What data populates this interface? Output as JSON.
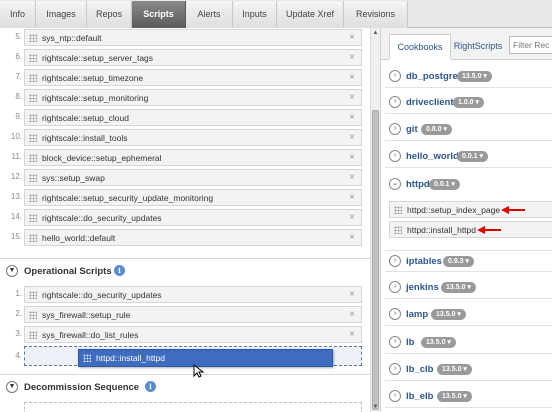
{
  "tabs": [
    "Info",
    "Images",
    "Repos",
    "Scripts",
    "Alerts",
    "Inputs",
    "Update Xref",
    "Revisions"
  ],
  "active_tab": "Scripts",
  "boot_scripts": [
    {
      "num": "5.",
      "name": "sys_ntp::default"
    },
    {
      "num": "6.",
      "name": "rightscale::setup_server_tags"
    },
    {
      "num": "7.",
      "name": "rightscale::setup_timezone"
    },
    {
      "num": "8.",
      "name": "rightscale::setup_monitoring"
    },
    {
      "num": "9.",
      "name": "rightscale::setup_cloud"
    },
    {
      "num": "10.",
      "name": "rightscale::install_tools"
    },
    {
      "num": "11.",
      "name": "block_device::setup_ephemeral"
    },
    {
      "num": "12.",
      "name": "sys::setup_swap"
    },
    {
      "num": "13.",
      "name": "rightscale::setup_security_update_monitoring"
    },
    {
      "num": "14.",
      "name": "rightscale::do_security_updates"
    },
    {
      "num": "15.",
      "name": "hello_world::default"
    }
  ],
  "remove_symbol": "×",
  "operational": {
    "title": "Operational Scripts",
    "scripts": [
      {
        "num": "1.",
        "name": "rightscale::do_security_updates"
      },
      {
        "num": "2.",
        "name": "sys_firewall::setup_rule"
      },
      {
        "num": "3.",
        "name": "sys_firewall::do_list_rules"
      }
    ],
    "drop_num": "4.",
    "dragging": "httpd::install_httpd"
  },
  "decommission": {
    "title": "Decommission Sequence"
  },
  "info_symbol": "i",
  "right_panel": {
    "tabs": [
      "Cookbooks",
      "RightScripts"
    ],
    "active_tab": "Cookbooks",
    "filter_placeholder": "Filter Rec",
    "cookbooks": [
      {
        "name": "db_postgres",
        "version": "13.5.0",
        "expanded": false
      },
      {
        "name": "driveclient",
        "version": "1.0.0",
        "expanded": false
      },
      {
        "name": "git",
        "version": "0.8.0",
        "expanded": false
      },
      {
        "name": "hello_world",
        "version": "0.0.1",
        "expanded": false
      },
      {
        "name": "httpd",
        "version": "0.0.1",
        "expanded": true
      },
      {
        "name": "iptables",
        "version": "0.9.3",
        "expanded": false
      },
      {
        "name": "jenkins",
        "version": "13.5.0",
        "expanded": false
      },
      {
        "name": "lamp",
        "version": "13.5.0",
        "expanded": false
      },
      {
        "name": "lb",
        "version": "13.5.0",
        "expanded": false
      },
      {
        "name": "lb_clb",
        "version": "13.5.0",
        "expanded": false
      },
      {
        "name": "lb_elb",
        "version": "13.5.0",
        "expanded": false
      }
    ],
    "httpd_recipes": [
      "httpd::setup_index_page",
      "httpd::install_httpd"
    ]
  },
  "colors": {
    "accent": "#2c5591",
    "drag": "#3e6cc0",
    "arrow": "#e00000",
    "badge": "#9a9a9a"
  }
}
